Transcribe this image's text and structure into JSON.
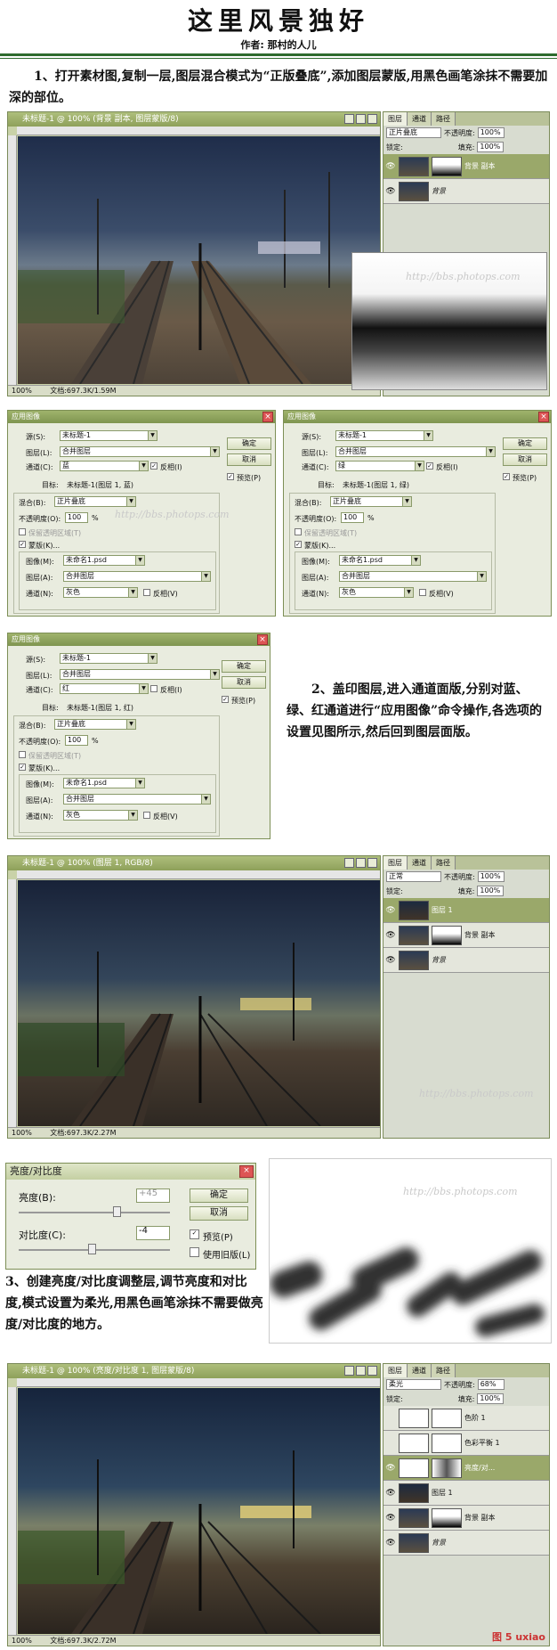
{
  "header": {
    "title": "这里风景独好",
    "author": "作者: 那村的人儿"
  },
  "step1": "1、打开素材图,复制一层,图层混合模式为“正版叠底”,添加图层蒙版,用黑色画笔涂抹不需要加深的部位。",
  "step2": "2、盖印图层,进入通道面版,分别对蓝、绿、红通道进行“应用图像”命令操作,各选项的设置见图所示,然后回到图层面版。",
  "step3": "3、创建亮度/对比度调整层,调节亮度和对比度,模式设置为柔光,用黑色画笔涂抹不需要做亮度/对比度的地方。",
  "win1": {
    "title": "未标题-1 @ 100% (背景 副本, 图层蒙版/8)",
    "zoom": "100%",
    "doc": "文档:697.3K/1.59M",
    "tabs": [
      "图层",
      "通道",
      "路径"
    ],
    "mode": "正片叠底",
    "opacity_label": "不透明度:",
    "opacity": "100%",
    "lock": "锁定:",
    "fill_label": "填充:",
    "fill": "100%",
    "layers": [
      "背景 副本",
      "背景"
    ],
    "watermark": "http://bbs.photops.com"
  },
  "apply_blue": {
    "title": "应用图像",
    "source_label": "源(S):",
    "source": "未标题-1",
    "layer_label": "图层(L):",
    "layer": "合并图层",
    "channel_label": "通道(C):",
    "channel": "蓝",
    "invert": "反相(I)",
    "target_label": "目标:",
    "target": "未标题-1(图层 1, 蓝)",
    "blend_label": "混合(B):",
    "blend": "正片叠底",
    "opacity_label": "不透明度(O):",
    "opacity": "100",
    "pct": "%",
    "preserve": "保留透明区域(T)",
    "mask": "蒙版(K)...",
    "image_label": "图像(M):",
    "image": "未命名1.psd",
    "mlayer_label": "图层(A):",
    "mlayer": "合并图层",
    "mchannel_label": "通道(N):",
    "mchannel": "灰色",
    "minvert": "反相(V)",
    "ok": "确定",
    "cancel": "取消",
    "preview": "预览(P)"
  },
  "apply_green": {
    "channel": "绿",
    "target": "未标题-1(图层 1, 绿)"
  },
  "apply_red": {
    "channel": "红",
    "target": "未标题-1(图层 1, 红)"
  },
  "win2": {
    "title": "未标题-1 @ 100% (图层 1, RGB/8)",
    "zoom": "100%",
    "doc": "文档:697.3K/2.27M",
    "mode": "正常",
    "opacity": "100%",
    "fill": "100%",
    "layers": [
      "图层 1",
      "背景 副本",
      "背景"
    ]
  },
  "bc": {
    "title": "亮度/对比度",
    "brightness_label": "亮度(B):",
    "brightness": "+45",
    "contrast_label": "对比度(C):",
    "contrast": "-4",
    "ok": "确定",
    "cancel": "取消",
    "preview": "预览(P)",
    "legacy": "使用旧版(L)"
  },
  "win3": {
    "title": "未标题-1 @ 100% (亮度/对比度 1, 图层蒙版/8)",
    "zoom": "100%",
    "doc": "文档:697.3K/2.72M",
    "mode": "柔光",
    "opacity": "68%",
    "fill": "100%",
    "layers": [
      "色阶 1",
      "色彩平衡 1",
      "亮度/对...",
      "图层 1",
      "背景 副本",
      "背景"
    ]
  },
  "footer_mark": "图 5 uxiao"
}
